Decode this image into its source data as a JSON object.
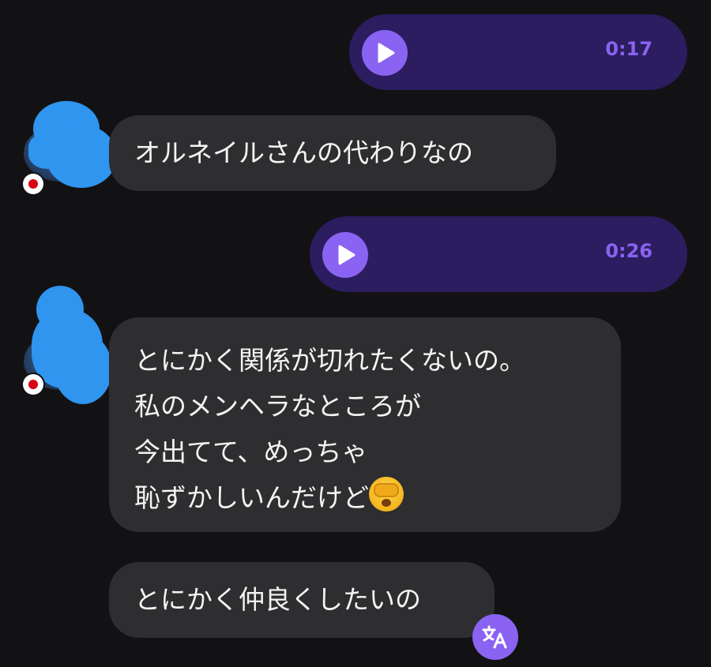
{
  "colors": {
    "background": "#121214",
    "outgoing_bubble": "#2b1d5f",
    "incoming_bubble": "#2e2e30",
    "accent": "#8a63f2"
  },
  "messages": {
    "voice1": {
      "duration": "0:17",
      "icon": "play-icon"
    },
    "text1": {
      "lines": [
        "オルネイルさんの代わりなの"
      ]
    },
    "voice2": {
      "duration": "0:26",
      "icon": "play-icon"
    },
    "text2": {
      "lines": [
        "とにかく関係が切れたくないの。",
        "私のメンヘラなところが",
        "今出てて、めっちゃ",
        "恥ずかしいんだけど"
      ],
      "emoji": "face-with-open-eyes-and-hand-over-mouth"
    },
    "text3": {
      "lines": [
        "とにかく仲良くしたいの"
      ]
    }
  },
  "icons": {
    "translate": "translate-icon",
    "flag": "japan-flag-icon"
  }
}
